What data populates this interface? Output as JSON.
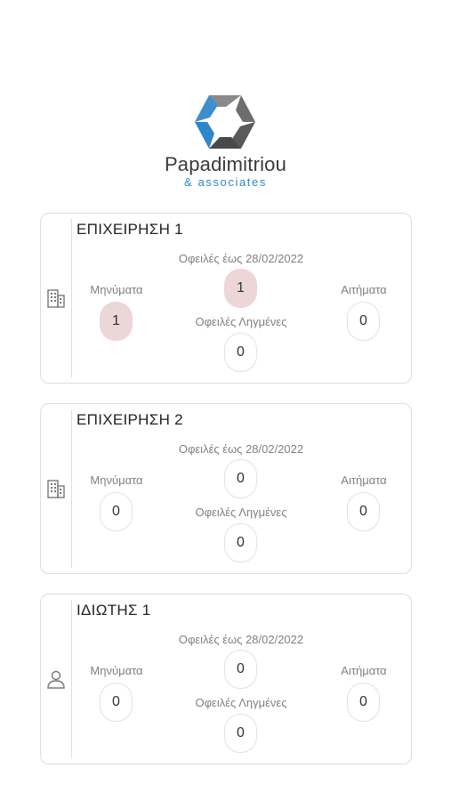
{
  "brand": {
    "name": "Papadimitriou",
    "sub": "& associates"
  },
  "cards": [
    {
      "title": "ΕΠΙΧΕΙΡΗΣΗ 1",
      "icon": "building-icon",
      "due_label": "Οφειλές έως 28/02/2022",
      "due_value": "1",
      "messages_label": "Μηνύματα",
      "messages_value": "1",
      "requests_label": "Αιτήματα",
      "requests_value": "0",
      "overdue_label": "Οφειλές Ληγμένες",
      "overdue_value": "0"
    },
    {
      "title": "ΕΠΙΧΕΙΡΗΣΗ 2",
      "icon": "building-icon",
      "due_label": "Οφειλές έως 28/02/2022",
      "due_value": "0",
      "messages_label": "Μηνύματα",
      "messages_value": "0",
      "requests_label": "Αιτήματα",
      "requests_value": "0",
      "overdue_label": "Οφειλές Ληγμένες",
      "overdue_value": "0"
    },
    {
      "title": "ΙΔΙΩΤΗΣ 1",
      "icon": "person-icon",
      "due_label": "Οφειλές έως 28/02/2022",
      "due_value": "0",
      "messages_label": "Μηνύματα",
      "messages_value": "0",
      "requests_label": "Αιτήματα",
      "requests_value": "0",
      "overdue_label": "Οφειλές Ληγμένες",
      "overdue_value": "0"
    }
  ],
  "colors": {
    "highlight": "#ecd6d8",
    "brand_blue": "#2f86c8",
    "brand_gray": "#3a3a3a"
  }
}
